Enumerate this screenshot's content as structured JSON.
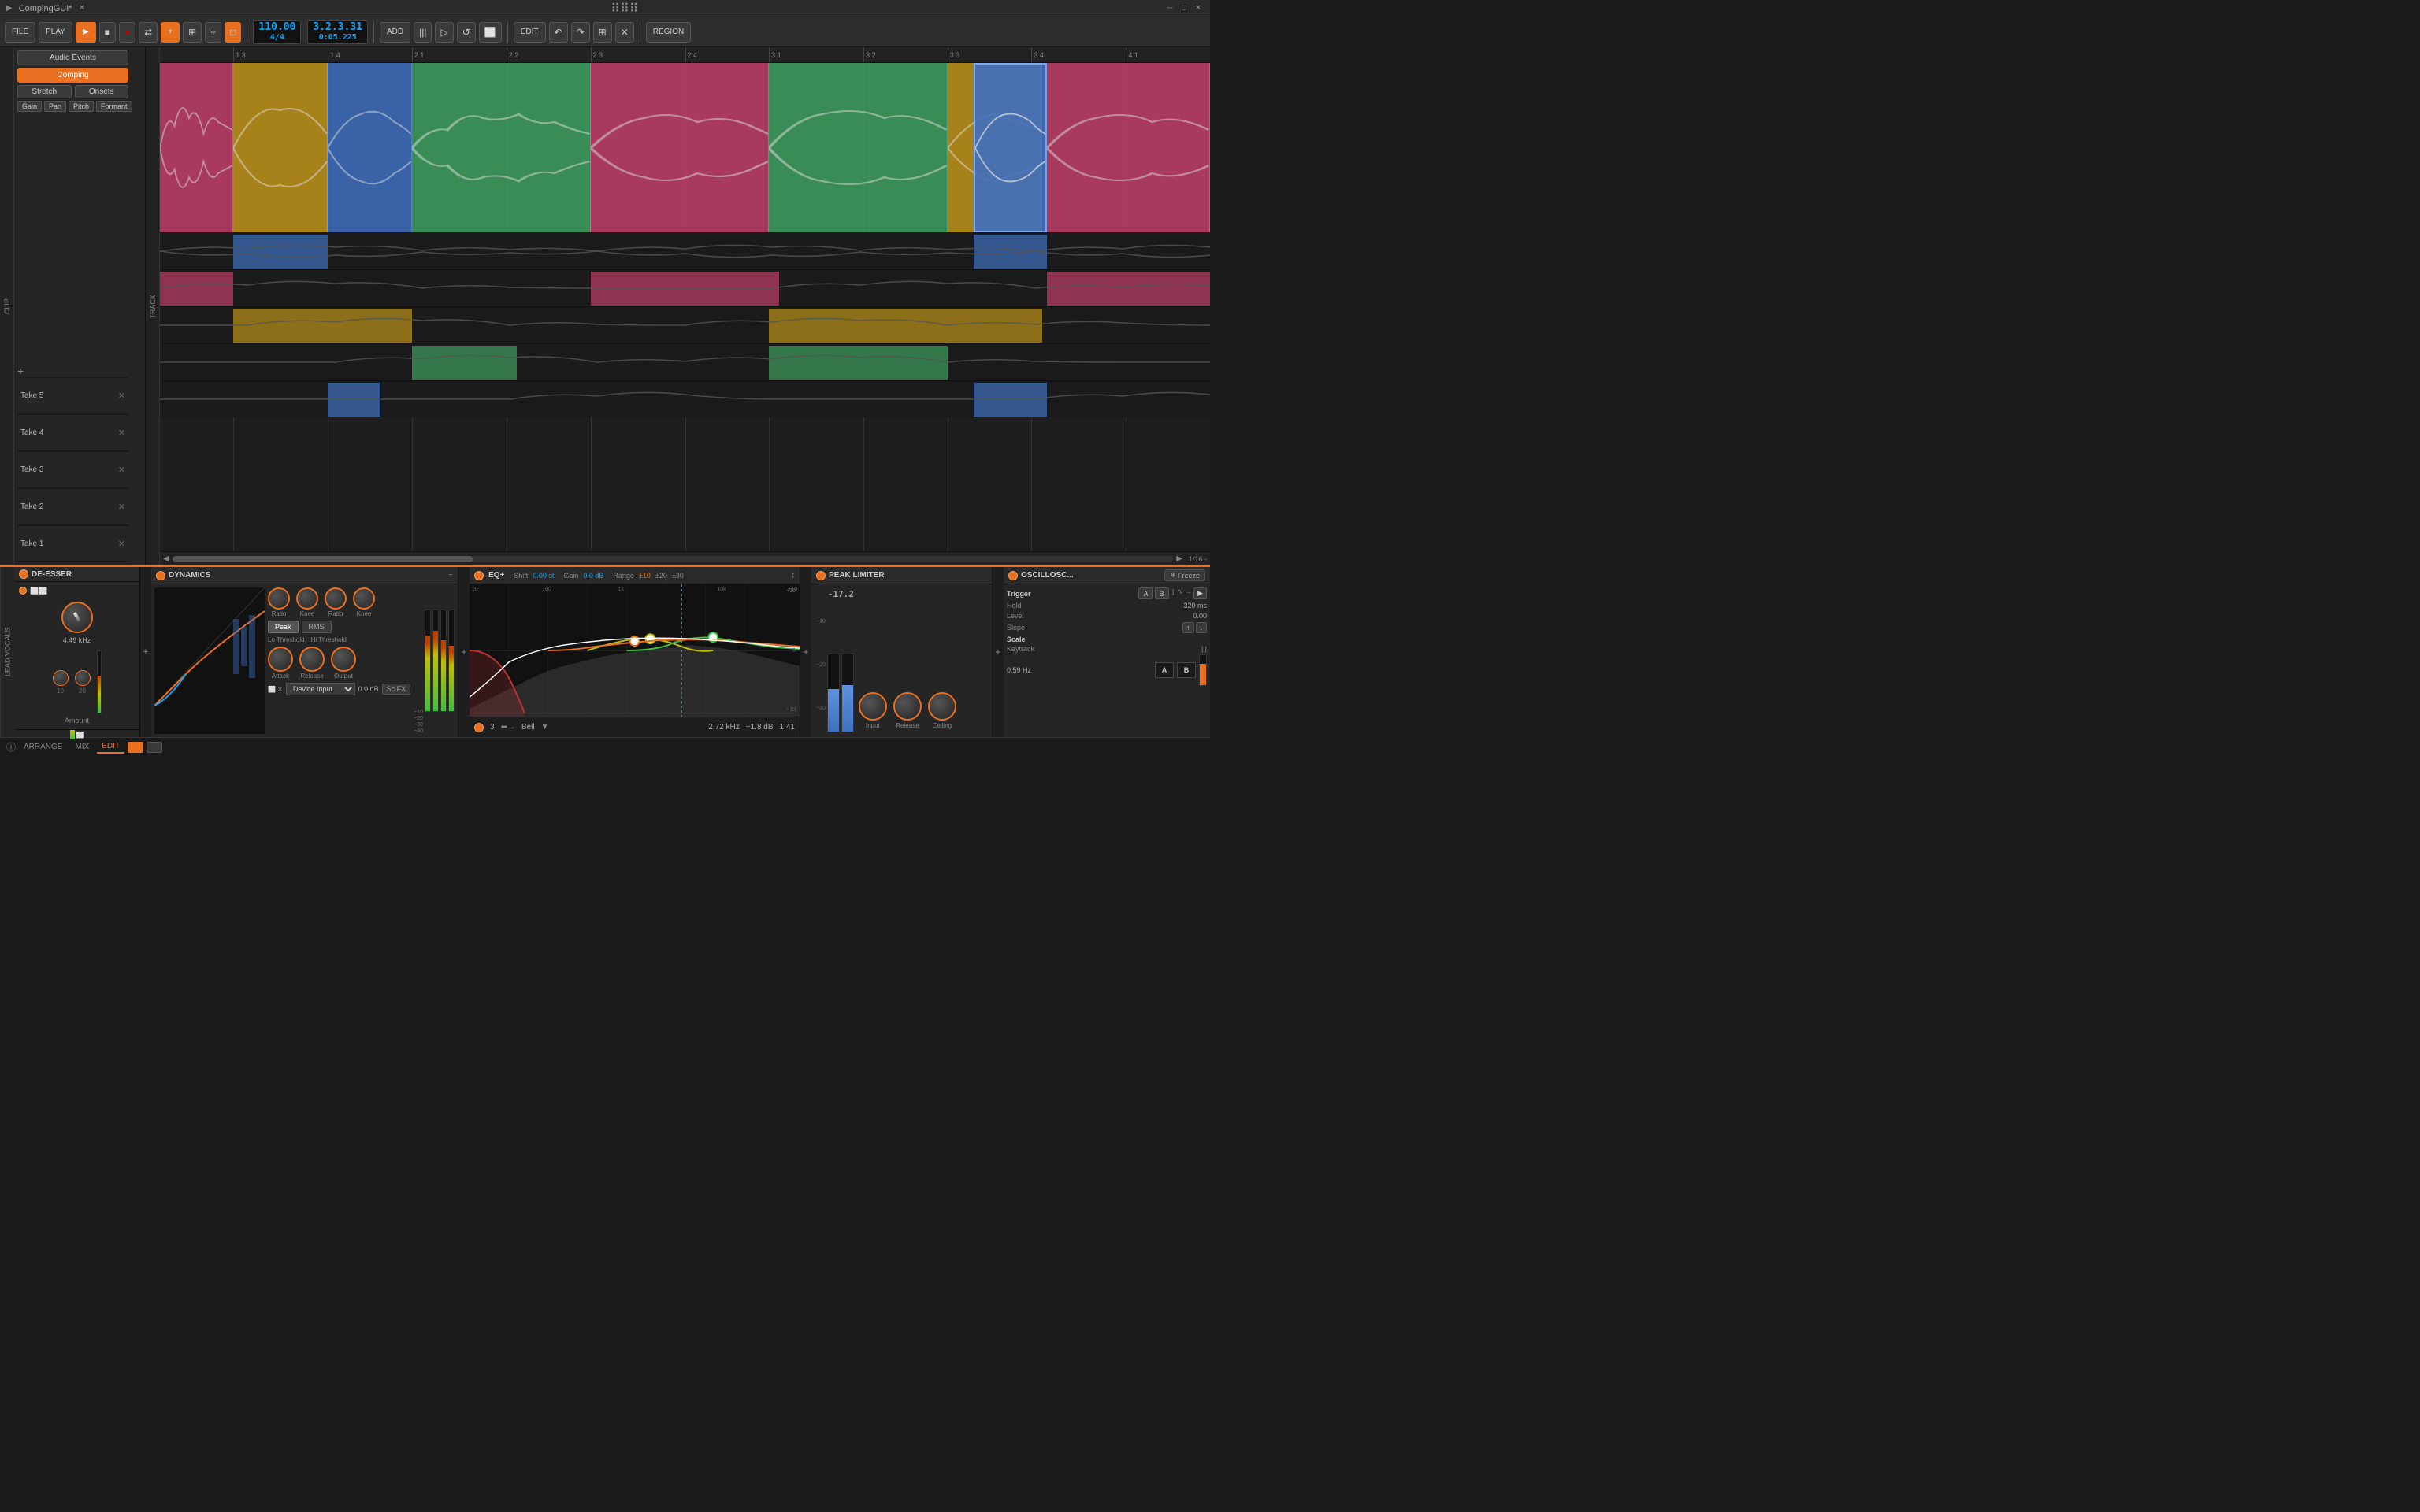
{
  "app": {
    "title": "CompingGUI*"
  },
  "toolbar": {
    "file_label": "FILE",
    "play_label": "PLAY",
    "tempo": "110.00",
    "time_sig": "4/4",
    "position": "3.2.3.31",
    "position2": "0:05.225",
    "add_label": "ADD",
    "edit_label": "EDIT",
    "region_label": "REGION"
  },
  "track_panel": {
    "audio_events_label": "Audio Events",
    "comping_label": "Comping",
    "stretch_label": "Stretch",
    "onsets_label": "Onsets",
    "gain_label": "Gain",
    "pan_label": "Pan",
    "pitch_label": "Pitch",
    "formant_label": "Formant"
  },
  "tracks": [
    {
      "name": "Take 5",
      "color": "gray"
    },
    {
      "name": "Take 4",
      "color": "pink"
    },
    {
      "name": "Take 3",
      "color": "gold"
    },
    {
      "name": "Take 2",
      "color": "green"
    },
    {
      "name": "Take 1",
      "color": "blue"
    }
  ],
  "ruler_marks": [
    "1.3",
    "1.4",
    "2.1",
    "2.2",
    "2.3",
    "2.4",
    "3.1",
    "3.2",
    "3.3",
    "3.4",
    "4.1"
  ],
  "de_esser": {
    "title": "DE-ESSER",
    "freq": "4.49 kHz",
    "amount_label": "Amount",
    "level_label": "10",
    "level2_label": "20"
  },
  "dynamics": {
    "title": "DYNAMICS",
    "ratio1_label": "Ratio",
    "knee1_label": "Knee",
    "ratio2_label": "Ratio",
    "knee2_label": "Knee",
    "lo_threshold_label": "Lo Threshold",
    "hi_threshold_label": "Hi Threshold",
    "attack_label": "Attack",
    "release_label": "Release",
    "output_label": "Output",
    "peak_label": "Peak",
    "rms_label": "RMS",
    "input_label": "Device Input",
    "gain_val": "0.0 dB",
    "sc_fx_label": "Sc FX"
  },
  "eq": {
    "title": "EQ+",
    "shift_label": "Shift",
    "shift_val": "0.00 st",
    "gain_label": "Gain",
    "gain_val": "0.0 dB",
    "range_label": "Range",
    "range_val": "±10",
    "range2": "±20",
    "range3": "±30",
    "freq_label": "2.72 kHz",
    "db_label": "+1.8 dB",
    "q_label": "1.41",
    "band_num": "3",
    "band_type": "Bell"
  },
  "peak_limiter": {
    "title": "PEAK LIMITER",
    "db_val": "-17.2",
    "input_label": "Input",
    "release_label": "Release",
    "ceiling_label": "Ceiling"
  },
  "oscilloscope": {
    "title": "OSCILLOSC...",
    "trigger_label": "Trigger",
    "hold_label": "Hold",
    "hold_val": "320 ms",
    "level_label": "Level",
    "level_val": "0.00",
    "slope_label": "Slope",
    "freeze_label": "Freeze",
    "scale_label": "Scale",
    "keytrack_label": "Keytrack",
    "scale_val": "0.59 Hz",
    "btn_a": "A",
    "btn_b": "B",
    "band_a": "A",
    "band_b": "B"
  },
  "status": {
    "arrange_label": "ARRANGE",
    "mix_label": "MIX",
    "edit_label": "EDIT",
    "page_info": "1/16 -"
  },
  "colors": {
    "orange": "#e87020",
    "blue_accent": "#00aaff",
    "pink": "#c0406a",
    "gold": "#c0941a",
    "blue_clip": "#4070c0",
    "green_clip": "#40a060",
    "gray_clip": "#555555"
  }
}
